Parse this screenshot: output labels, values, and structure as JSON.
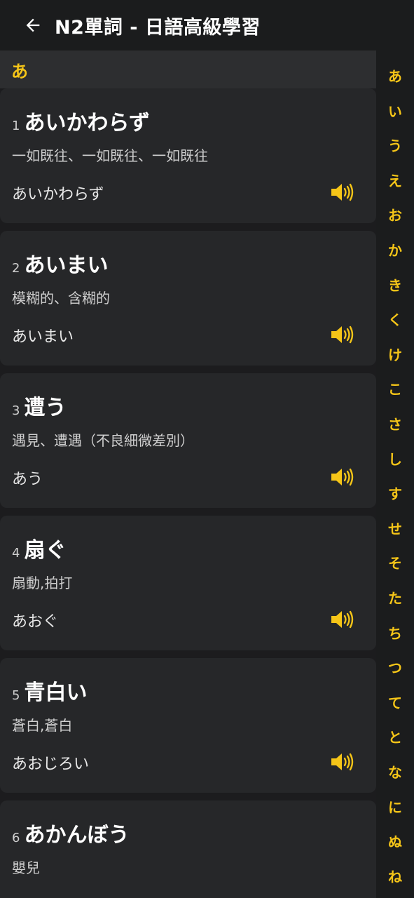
{
  "header": {
    "title": "N2單詞 - 日語高級學習",
    "back_icon": "arrow-left-icon"
  },
  "section": {
    "label": "あ"
  },
  "words": [
    {
      "index": "1",
      "word": "あいかわらず",
      "meaning": "一如既往、一如既往、一如既往",
      "reading": "あいかわらず"
    },
    {
      "index": "2",
      "word": "あいまい",
      "meaning": "模糊的、含糊的",
      "reading": "あいまい"
    },
    {
      "index": "3",
      "word": "遭う",
      "meaning": "遇見、遭遇（不良細微差別）",
      "reading": "あう"
    },
    {
      "index": "4",
      "word": "扇ぐ",
      "meaning": "扇動,拍打",
      "reading": "あおぐ"
    },
    {
      "index": "5",
      "word": "青白い",
      "meaning": "蒼白,蒼白",
      "reading": "あおじろい"
    },
    {
      "index": "6",
      "word": "あかんぼう",
      "meaning": "嬰兒",
      "reading": ""
    }
  ],
  "kana_index": [
    "あ",
    "い",
    "う",
    "え",
    "お",
    "か",
    "き",
    "く",
    "け",
    "こ",
    "さ",
    "し",
    "す",
    "せ",
    "そ",
    "た",
    "ち",
    "つ",
    "て",
    "と",
    "な",
    "に",
    "ぬ",
    "ね"
  ],
  "colors": {
    "accent": "#f5c518",
    "background": "#1c1c1e",
    "card": "#262729",
    "topbar": "#1b1c1d"
  }
}
